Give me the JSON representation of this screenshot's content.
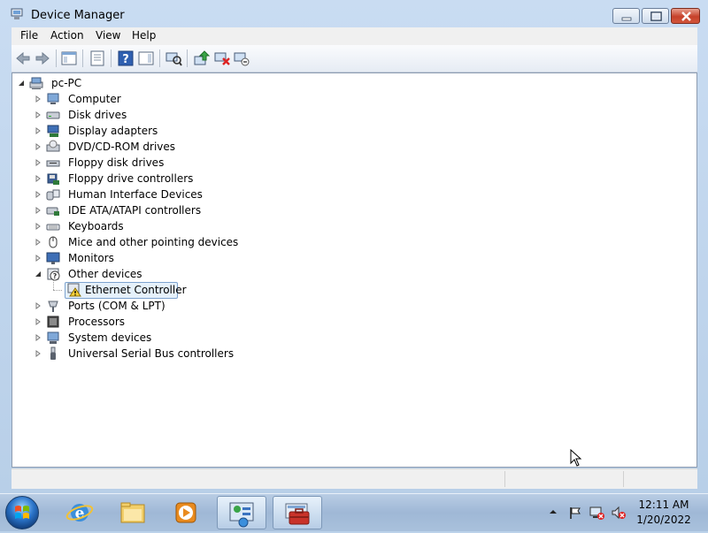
{
  "window": {
    "title": "Device Manager"
  },
  "menu": [
    "File",
    "Action",
    "View",
    "Help"
  ],
  "tree": {
    "root": "pc-PC",
    "categories": [
      {
        "label": "Computer",
        "icon": "computer-icon"
      },
      {
        "label": "Disk drives",
        "icon": "disk-drive-icon"
      },
      {
        "label": "Display adapters",
        "icon": "display-adapter-icon"
      },
      {
        "label": "DVD/CD-ROM drives",
        "icon": "dvd-drive-icon"
      },
      {
        "label": "Floppy disk drives",
        "icon": "floppy-disk-icon"
      },
      {
        "label": "Floppy drive controllers",
        "icon": "floppy-controller-icon"
      },
      {
        "label": "Human Interface Devices",
        "icon": "hid-icon"
      },
      {
        "label": "IDE ATA/ATAPI controllers",
        "icon": "ide-controller-icon"
      },
      {
        "label": "Keyboards",
        "icon": "keyboard-icon"
      },
      {
        "label": "Mice and other pointing devices",
        "icon": "mouse-icon"
      },
      {
        "label": "Monitors",
        "icon": "monitor-icon"
      },
      {
        "label": "Other devices",
        "icon": "unknown-device-icon",
        "expanded": true
      },
      {
        "label": "Ports (COM & LPT)",
        "icon": "port-icon"
      },
      {
        "label": "Processors",
        "icon": "processor-icon"
      },
      {
        "label": "System devices",
        "icon": "system-device-icon"
      },
      {
        "label": "Universal Serial Bus controllers",
        "icon": "usb-icon"
      }
    ],
    "child": {
      "label": "Ethernet Controller",
      "icon": "warning-device-icon",
      "parent": "Other devices"
    }
  },
  "taskbar": {
    "time": "12:11 AM",
    "date": "1/20/2022"
  },
  "colors": {
    "selection": "#e5f1fb",
    "selection_border": "#7da2ce",
    "close_button": "#c6412a"
  }
}
